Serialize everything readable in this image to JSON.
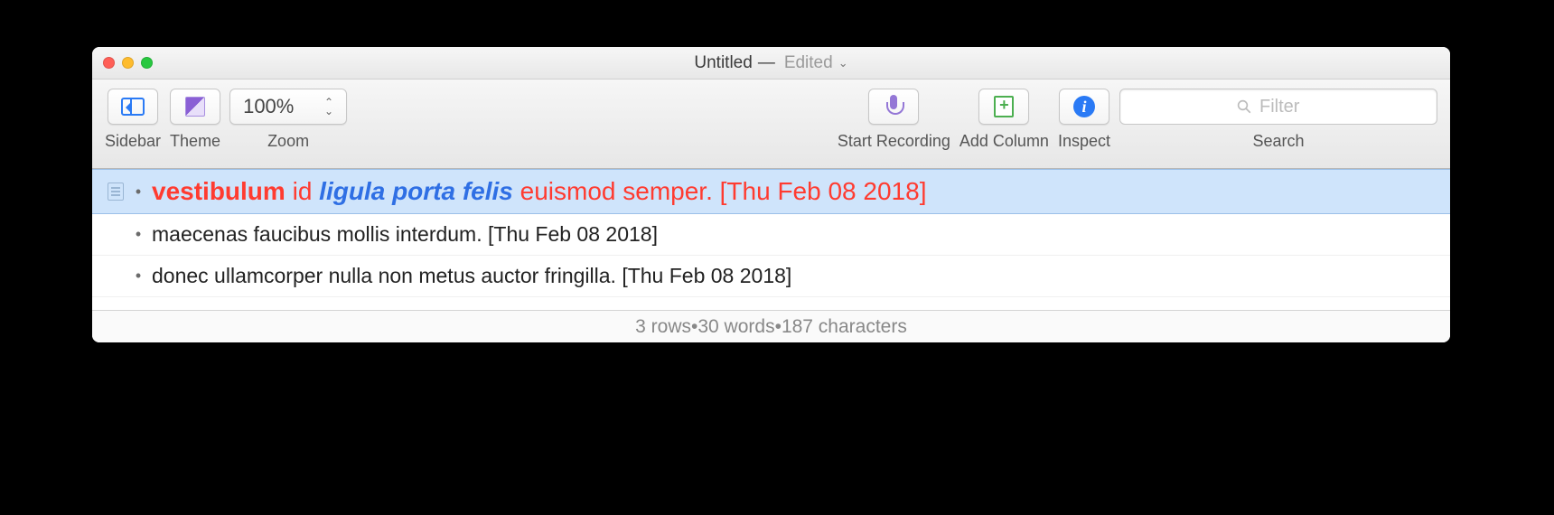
{
  "window": {
    "title": "Untitled",
    "doc_state": "Edited"
  },
  "toolbar": {
    "sidebar_label": "Sidebar",
    "theme_label": "Theme",
    "zoom_label": "Zoom",
    "zoom_value": "100%",
    "start_recording_label": "Start Recording",
    "add_column_label": "Add Column",
    "inspect_label": "Inspect",
    "search_label": "Search",
    "search_placeholder": "Filter"
  },
  "rows": [
    {
      "selected": true,
      "spans": [
        {
          "text": "vestibulum",
          "class": "sp-red-bold"
        },
        {
          "text": " id ",
          "class": "sp-red"
        },
        {
          "text": "ligula porta felis",
          "class": "sp-blue-italic"
        },
        {
          "text": " euismod semper. [Thu Feb 08 2018]",
          "class": "sp-red"
        }
      ]
    },
    {
      "selected": false,
      "spans": [
        {
          "text": "maecenas faucibus mollis interdum. [Thu Feb 08 2018]",
          "class": ""
        }
      ]
    },
    {
      "selected": false,
      "spans": [
        {
          "text": "donec ullamcorper nulla non metus auctor fringilla. [Thu Feb 08 2018]",
          "class": ""
        }
      ]
    }
  ],
  "status": {
    "rows": "3 rows",
    "words": "30 words",
    "characters": "187 characters",
    "sep": " • "
  }
}
